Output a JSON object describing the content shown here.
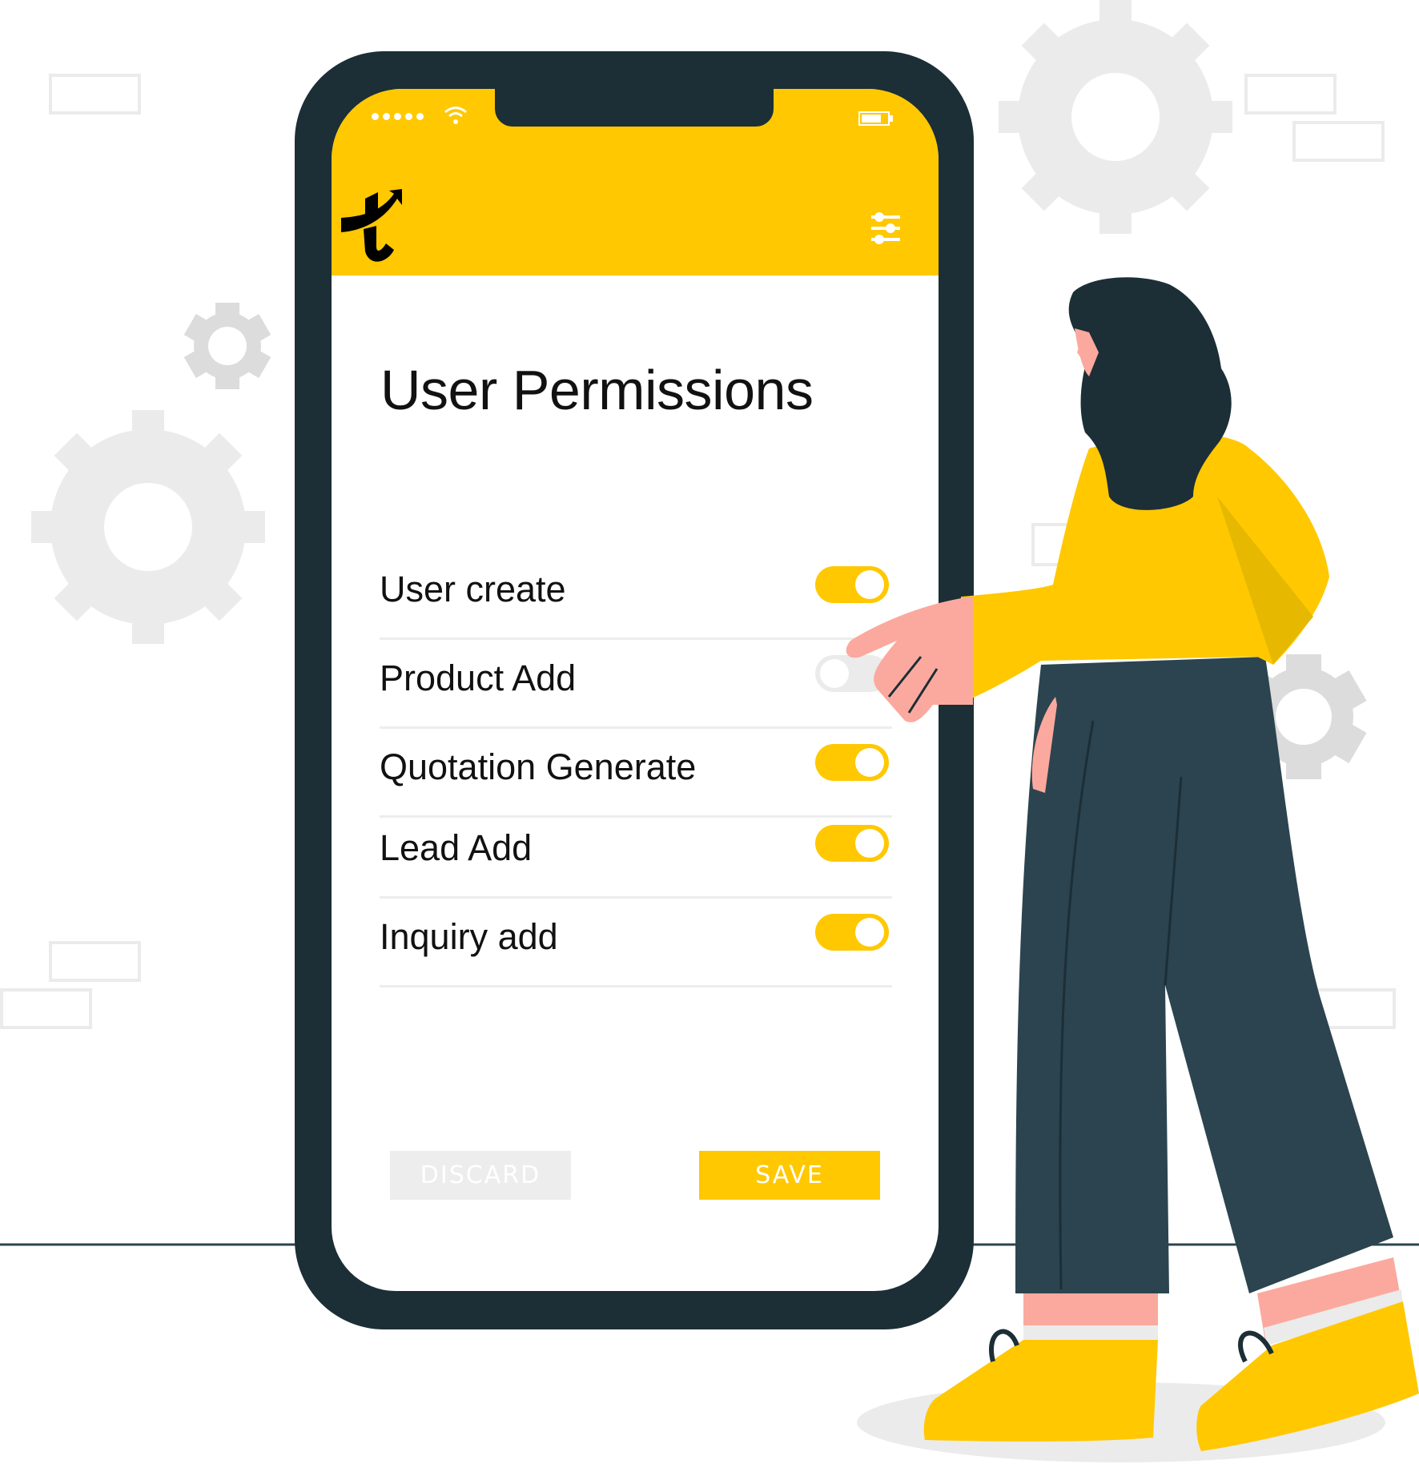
{
  "status_bar": {
    "signal_icon": "signal-dots-icon",
    "wifi_icon": "wifi-icon",
    "battery_icon": "battery-icon"
  },
  "header": {
    "logo_icon": "brand-t-arrow-logo",
    "filter_icon": "sliders-filter-icon"
  },
  "page": {
    "title": "User Permissions"
  },
  "permissions": [
    {
      "label": "User create",
      "enabled": true
    },
    {
      "label": "Product Add",
      "enabled": false
    },
    {
      "label": "Quotation Generate",
      "enabled": true
    },
    {
      "label": "Lead Add",
      "enabled": true
    },
    {
      "label": "Inquiry add",
      "enabled": true
    }
  ],
  "actions": {
    "discard_label": "DISCARD",
    "save_label": "SAVE"
  },
  "colors": {
    "accent": "#FFC800",
    "phone_frame": "#1C2E36",
    "toggle_off": "#EBEBEB",
    "discard_bg": "#EDEDED",
    "pants": "#2C444F",
    "skin": "#FBA99E",
    "gear": "#EBEBEB"
  }
}
